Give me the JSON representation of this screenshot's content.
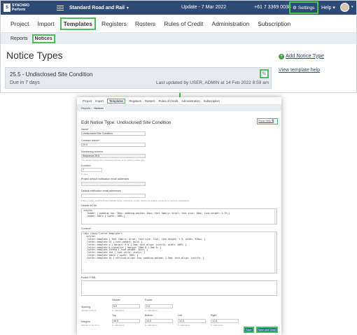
{
  "appbar": {
    "logo_mark": "S",
    "logo_text_line1": "SYNCHRO",
    "logo_text_line2": "Perform",
    "company": "Standard Road and Rail",
    "update": "Update - 7 Mar 2022",
    "phone": "+61 7 3369 0038",
    "settings": "Settings",
    "help": "Help"
  },
  "nav": [
    "Project",
    "Import",
    "Templates",
    "Registers",
    "Rosters",
    "Rules of Credit",
    "Administration",
    "Subscription"
  ],
  "subnav": [
    "Reports",
    "Notices"
  ],
  "page": {
    "title": "Notice Types",
    "add_label": "Add Notice Type",
    "view_help": "View template help"
  },
  "card": {
    "title": "25.5 - Undisclosed Site Condition",
    "due": "Due in 7 days",
    "updated": "Last updated by USER, ADMIN at 14 Feb 2022 8:59 am"
  },
  "edit": {
    "heading": "Edit Notice Type: Undisclosed Site Condition",
    "show_help": "Show Help",
    "name_label": "Name*",
    "name_value": "Undisclosed Site Condition",
    "clause_label": "Contract clause*",
    "clause_value": "25.5",
    "scheme_label": "Numbering scheme",
    "scheme_value": "Sequence 25.5",
    "scheme_hint": "You cannot change the numbering scheme of an existing notice type.",
    "duration_label": "Duration",
    "duration_value": "7",
    "duration_hint": "in days",
    "proj_email_label": "Project default notification email addresses",
    "default_email_label": "Default notification email addresses",
    "default_email_hint": "These emails, and the Project Default notice notification emails, will be the default recipients for Notices notifications.",
    "header_html_label": "Header HTML",
    "header_html": "<style>\n  .header { padding-top: 30px; padding-bottom: 10px; font-family: Arial; font-size: 10pt; line-height: 1.2%;}\n  .header table { width: 100%;}",
    "content_label": "Content*",
    "content_html": "<div class=\"letter-template\">\n  <style>\n  .letter-template { font-family: Arial; font-size: 11pt; line-height: 1.5; width: 920px; }\n  .letter-template h1 { font-weight: bold; }\n  .letter-template p { margin: 0 0 1.5em; text-align: justify; width: 100%; }\n  .letter-template p.signature { margin: 20em 0 1.5em 0; }\n  .letter-template strong { font-weight: bold; }\n  .letter-template thd { font-style: italic; }\n  .letter-template table { width: 100%; }\n  .letter-template td { vertical-align: top; padding-bottom: 1.5em; text-align: justify; }",
    "footer_label": "Footer HTML",
    "spacing_label": "Spacing",
    "spacing_hint": "defaults to 5mm",
    "col_header": "Header",
    "col_footer": "Footer",
    "spacing_header": "5.0",
    "spacing_footer": "2.0",
    "margins_label": "Margins",
    "margins_hint": "defaults to 10.7mm",
    "col_top": "Top",
    "col_bottom": "Bottom",
    "col_left": "Left",
    "col_right": "Right",
    "margin_top": "40.0",
    "margin_bottom": "10.0",
    "margin_left": "12.5",
    "margin_right": "12.5",
    "unit_hint": "in millimetres",
    "save": "Save",
    "save_close": "Save and Close"
  },
  "colors": {
    "appbar": "#2e4a77",
    "highlight": "#43c35a",
    "primary_button": "#2d6ca2"
  }
}
